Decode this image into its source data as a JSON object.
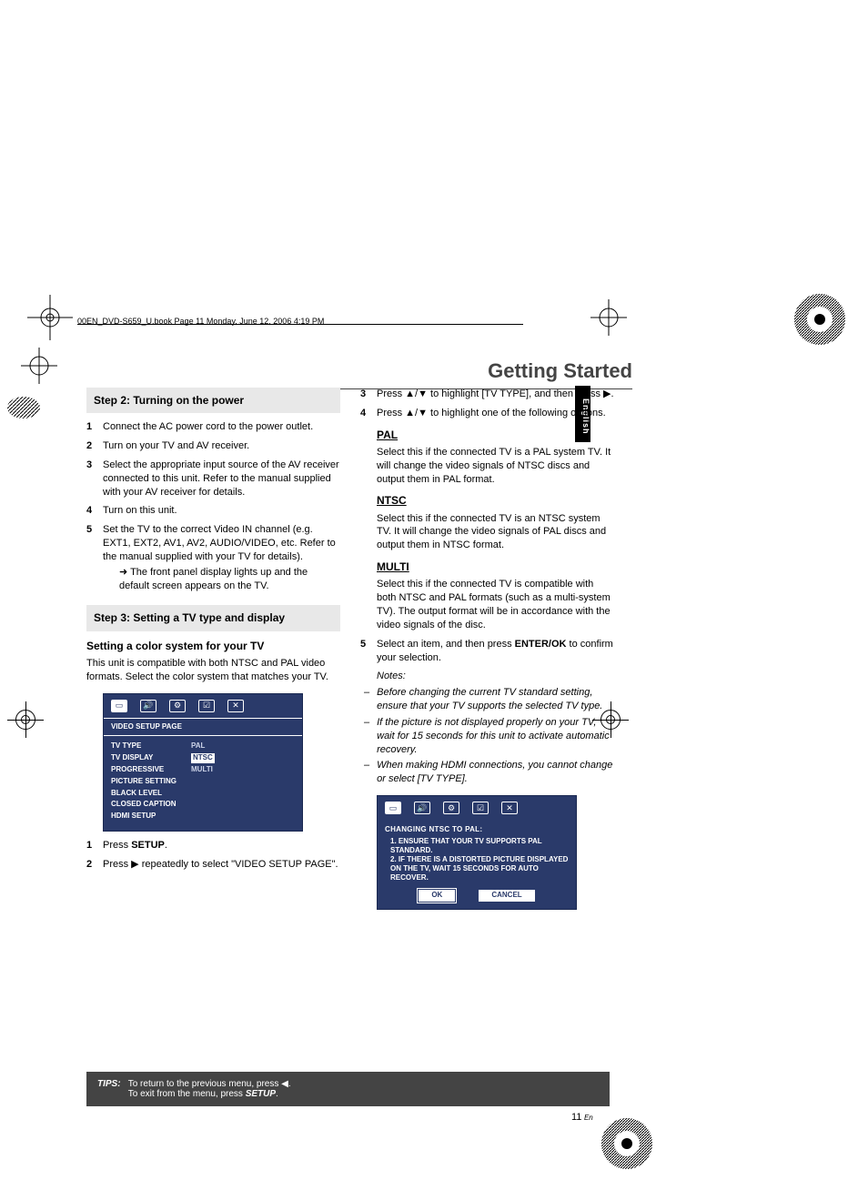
{
  "print": {
    "bookline": "00EN_DVD-S659_U.book  Page 11  Monday, June 12, 2006  4:19 PM"
  },
  "header": {
    "title": "Getting Started"
  },
  "langtab": "English",
  "left": {
    "step2_title": "Step 2: Turning on the power",
    "s2_1": "Connect the AC power cord to the power outlet.",
    "s2_2": "Turn on your TV and AV receiver.",
    "s2_3": "Select the appropriate input source of the AV receiver connected to this unit. Refer to the manual supplied with your AV receiver for details.",
    "s2_4": "Turn on this unit.",
    "s2_5": "Set the TV to the correct Video IN channel (e.g. EXT1, EXT2, AV1, AV2, AUDIO/VIDEO, etc. Refer to the manual supplied with your TV for details).",
    "s2_5_arrow": "➜ The front panel display lights up and the default screen appears on the TV.",
    "step3_title": "Step 3: Setting a TV type and display",
    "subhead": "Setting a color system for your TV",
    "subbody": "This unit is compatible with both NTSC and PAL video formats. Select the color system that matches your TV.",
    "menu": {
      "title": "VIDEO SETUP PAGE",
      "left": [
        "TV TYPE",
        "TV DISPLAY",
        "PROGRESSIVE",
        "PICTURE SETTING",
        "BLACK LEVEL",
        "CLOSED CAPTION",
        "HDMI SETUP"
      ],
      "right": [
        "PAL",
        "NTSC",
        "MULTI"
      ]
    },
    "p1_pre": "Press ",
    "p1_b": "SETUP",
    "p1_post": ".",
    "p2": "Press ▶ repeatedly to select \"VIDEO SETUP PAGE\"."
  },
  "right": {
    "r3": "Press ▲/▼ to highlight [TV TYPE], and then press ▶.",
    "r4": "Press ▲/▼ to highlight one of the following options.",
    "pal_h": "PAL",
    "pal_b": "Select this if the connected TV is a PAL system TV. It will change the video signals of NTSC discs and output them in PAL format.",
    "ntsc_h": "NTSC",
    "ntsc_b": "Select this if the connected TV is an NTSC system TV. It will change the video signals of PAL discs and output them in NTSC format.",
    "multi_h": "MULTI",
    "multi_b": "Select this if the connected TV is compatible with both NTSC and PAL formats (such as a multi-system TV). The output format will be in accordance with the video signals of the disc.",
    "r5a": "Select an item, and then press ",
    "r5b": "ENTER/OK",
    "r5c": " to confirm your selection.",
    "notes_h": "Notes:",
    "note1": "Before changing the current TV standard setting, ensure that your TV supports the selected TV type.",
    "note2": "If the picture is not displayed properly on your TV, wait for 15 seconds for this unit to activate automatic recovery.",
    "note3": "When making HDMI connections, you cannot change or select [TV TYPE].",
    "dialog": {
      "title": "CHANGING  NTSC  TO  PAL:",
      "l1": "1. ENSURE  THAT  YOUR  TV  SUPPORTS PAL  STANDARD.",
      "l2": "2. IF  THERE  IS  A  DISTORTED  PICTURE DISPLAYED  ON  THE  TV,  WAIT  15 SECONDS  FOR  AUTO  RECOVER.",
      "ok": "OK",
      "cancel": "CANCEL"
    }
  },
  "tips": {
    "label": "TIPS:",
    "l1": "To return to the previous menu, press ◀.",
    "l2_a": "To exit from the menu, press ",
    "l2_b": "SETUP",
    "l2_c": "."
  },
  "pagenum": {
    "n": "11",
    "suf": "En"
  }
}
